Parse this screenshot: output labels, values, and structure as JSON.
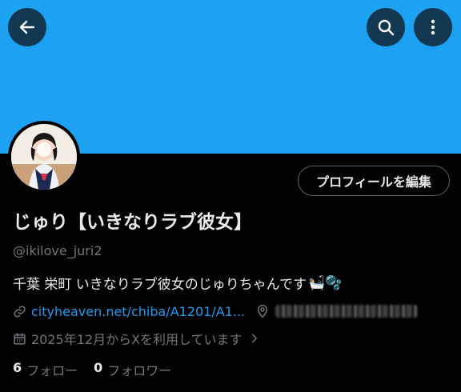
{
  "header": {
    "back_icon": "arrow-left-icon",
    "search_icon": "search-icon",
    "more_icon": "more-vertical-icon",
    "banner_color": "#1da1f2"
  },
  "profile": {
    "edit_button_label": "プロフィールを編集",
    "display_name": "じゅり【いきなりラブ彼女】",
    "handle": "@ikilove_juri2",
    "bio": "千葉 栄町 いきなりラブ彼女のじゅりちゃんです",
    "bio_emoji": "🛀🫧",
    "link_text": "cityheaven.net/chiba/A1201/A1...",
    "joined": "2025年12月からXを利用しています"
  },
  "stats": {
    "following_count": "6",
    "following_label": "フォロー",
    "followers_count": "0",
    "followers_label": "フォロワー"
  },
  "colors": {
    "accent": "#1d9bf0",
    "text_primary": "#e7e9ea",
    "text_secondary": "#71767b",
    "background": "#000000"
  }
}
